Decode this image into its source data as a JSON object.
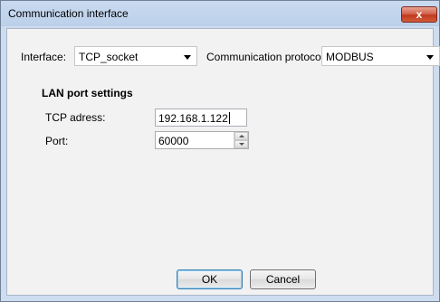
{
  "window": {
    "title": "Communication interface",
    "close_label": "x"
  },
  "interface": {
    "label": "Interface:",
    "value": "TCP_socket"
  },
  "protocol": {
    "label": "Communication protocol:",
    "value": "MODBUS"
  },
  "lan": {
    "section_title": "LAN port settings",
    "tcp_label": "TCP adress:",
    "tcp_value": "192.168.1.122",
    "port_label": "Port:",
    "port_value": "60000"
  },
  "buttons": {
    "ok": "OK",
    "cancel": "Cancel"
  },
  "colors": {
    "title_bar": "#bcd0ea",
    "client_bg": "#f2f2f2",
    "close_button": "#c1391e"
  }
}
